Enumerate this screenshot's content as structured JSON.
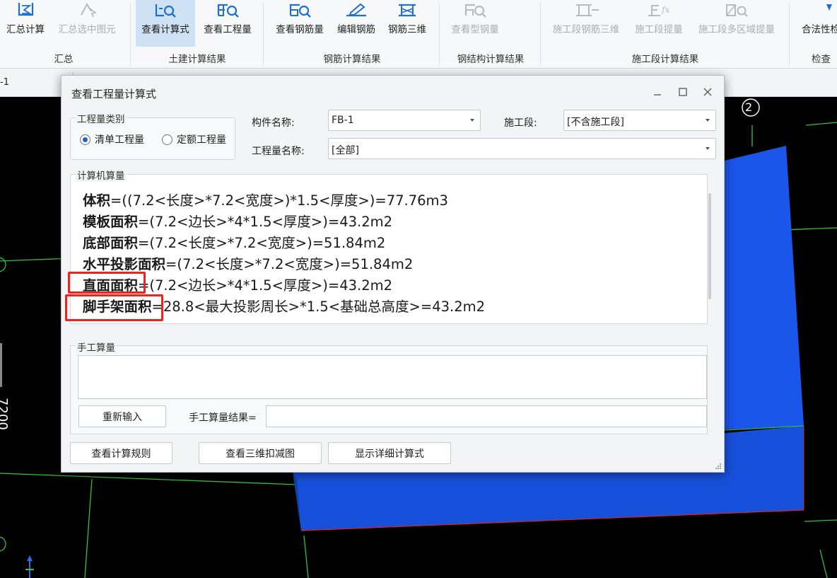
{
  "ribbon": {
    "groups": [
      {
        "label": "汇总",
        "buttons": [
          {
            "label": "汇总计算",
            "icon": "sum-calc-icon",
            "disabled": false,
            "active": false
          },
          {
            "label": "汇总选中图元",
            "icon": "sum-selected-icon",
            "disabled": true,
            "active": false
          }
        ]
      },
      {
        "label": "土建计算结果",
        "buttons": [
          {
            "label": "查看计算式",
            "icon": "view-formula-icon",
            "disabled": false,
            "active": true
          },
          {
            "label": "查看工程量",
            "icon": "view-quantity-icon",
            "disabled": false,
            "active": false
          }
        ]
      },
      {
        "label": "钢筋计算结果",
        "buttons": [
          {
            "label": "查看钢筋量",
            "icon": "view-rebar-icon",
            "disabled": false,
            "active": false
          },
          {
            "label": "编辑钢筋",
            "icon": "edit-rebar-icon",
            "disabled": false,
            "active": false
          },
          {
            "label": "钢筋三维",
            "icon": "rebar-3d-icon",
            "disabled": false,
            "active": false
          }
        ]
      },
      {
        "label": "钢结构计算结果",
        "buttons": [
          {
            "label": "查看型钢量",
            "icon": "view-steel-icon",
            "disabled": true,
            "active": false
          }
        ]
      },
      {
        "label": "施工段计算结果",
        "buttons": [
          {
            "label": "施工段钢筋三维",
            "icon": "segment-rebar-3d-icon",
            "disabled": true,
            "active": false
          },
          {
            "label": "施工段提量",
            "icon": "segment-quantity-icon",
            "disabled": true,
            "active": false
          },
          {
            "label": "施工段多区域提量",
            "icon": "segment-multi-area-icon",
            "disabled": true,
            "active": false
          }
        ]
      },
      {
        "label": "检查",
        "buttons": [
          {
            "label": "合法性检",
            "icon": "validity-check-icon",
            "disabled": false,
            "active": false
          }
        ]
      }
    ]
  },
  "strip": {
    "text": "-1"
  },
  "viewport": {
    "dimension_label": "7200",
    "axis_marker": "2",
    "block_color": "#1a56ea",
    "grid_color": "#2fc43a"
  },
  "dialog": {
    "title": "查看工程量计算式",
    "category": {
      "legend": "工程量类别",
      "options": [
        {
          "label": "清单工程量",
          "selected": true
        },
        {
          "label": "定额工程量",
          "selected": false
        }
      ]
    },
    "component": {
      "label": "构件名称:",
      "value": "FB-1"
    },
    "segment": {
      "label": "施工段:",
      "value": "[不含施工段]"
    },
    "quantity_name": {
      "label": "工程量名称:",
      "value": "[全部]"
    },
    "computer": {
      "legend": "计算机算量",
      "lines": [
        {
          "name": "体积",
          "formula": "=((7.2<长度>*7.2<宽度>)*1.5<厚度>)=77.76m3"
        },
        {
          "name": "模板面积",
          "formula": "=(7.2<边长>*4*1.5<厚度>)=43.2m2"
        },
        {
          "name": "底部面积",
          "formula": "=(7.2<长度>*7.2<宽度>)=51.84m2"
        },
        {
          "name": "水平投影面积",
          "formula": "=(7.2<长度>*7.2<宽度>)=51.84m2"
        },
        {
          "name": "直面面积",
          "formula": "=(7.2<边长>*4*1.5<厚度>)=43.2m2"
        },
        {
          "name": "脚手架面积",
          "formula": "=28.8<最大投影周长>*1.5<基础总高度>=43.2m2"
        }
      ]
    },
    "manual": {
      "legend": "手工算量",
      "reenter_label": "重新输入",
      "result_label": "手工算量结果=",
      "result_value": ""
    },
    "buttons": {
      "view_rules": "查看计算规则",
      "view_3d_deduct": "查看三维扣减图",
      "show_detail": "显示详细计算式"
    },
    "highlight_color": "#e8261e"
  }
}
